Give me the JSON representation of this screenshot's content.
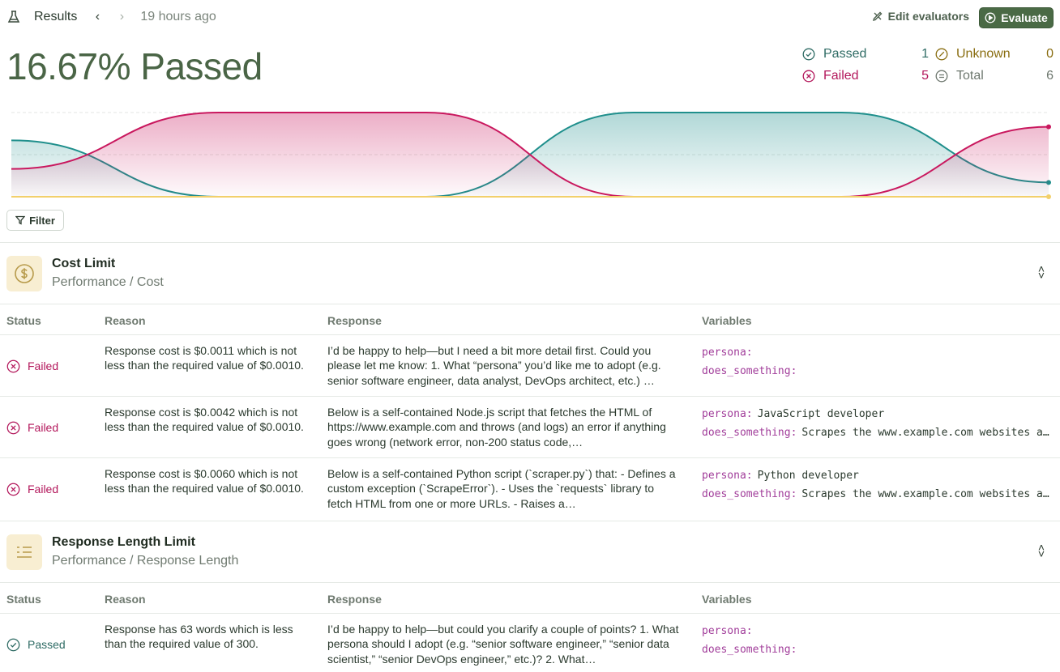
{
  "header": {
    "title": "Results",
    "time": "19 hours ago",
    "edit_evaluators": "Edit evaluators",
    "evaluate": "Evaluate"
  },
  "summary": {
    "headline": "16.67% Passed",
    "passed_label": "Passed",
    "passed_count": "1",
    "unknown_label": "Unknown",
    "unknown_count": "0",
    "failed_label": "Failed",
    "failed_count": "5",
    "total_label": "Total",
    "total_count": "6"
  },
  "chart_data": {
    "type": "area",
    "x": [
      0,
      1,
      2,
      3,
      4,
      5
    ],
    "series": [
      {
        "color": "#c9185e",
        "values": [
          0.33,
          1,
          1,
          0,
          0,
          0.83
        ]
      },
      {
        "color": "#1f8f8c",
        "values": [
          0.67,
          0,
          0,
          1,
          1,
          0.17
        ]
      },
      {
        "color": "#f2d06b",
        "values": [
          0,
          0,
          0,
          0,
          0,
          0
        ]
      }
    ],
    "ylim": [
      0,
      1
    ]
  },
  "filter": {
    "label": "Filter"
  },
  "columns": {
    "status": "Status",
    "reason": "Reason",
    "response": "Response",
    "variables": "Variables"
  },
  "sections": [
    {
      "title": "Cost Limit",
      "subtitle": "Performance / Cost",
      "rows": [
        {
          "status": "Failed",
          "reason": "Response cost is $0.0011 which is not less than the required value of $0.0010.",
          "response": "I’d be happy to help—but I need a bit more detail first. Could you please let me know: 1. What “persona” you’d like me to adopt (e.g. senior software engineer, data analyst, DevOps architect, etc.) …",
          "persona": "",
          "does_something": ""
        },
        {
          "status": "Failed",
          "reason": "Response cost is $0.0042 which is not less than the required value of $0.0010.",
          "response": "Below is a self-contained Node.js script that fetches the HTML of https://www.example.com and throws (and logs) an error if anything goes wrong (network error, non-200 status code,…",
          "persona": "JavaScript developer",
          "does_something": "Scrapes the www.example.com websites and throws an error"
        },
        {
          "status": "Failed",
          "reason": "Response cost is $0.0060 which is not less than the required value of $0.0010.",
          "response": "Below is a self-contained Python script (`scraper.py`) that: - Defines a custom exception (`ScrapeError`). - Uses the `requests` library to fetch HTML from one or more URLs. - Raises a…",
          "persona": "Python developer",
          "does_something": "Scrapes the www.example.com websites and throws an error"
        }
      ]
    },
    {
      "title": "Response Length Limit",
      "subtitle": "Performance / Response Length",
      "rows": [
        {
          "status": "Passed",
          "reason": "Response has 63 words which is less than the required value of 300.",
          "response": "I’d be happy to help—but could you clarify a couple of points? 1. What persona should I adopt (e.g. “senior software engineer,” “senior data scientist,” “senior DevOps engineer,” etc.)? 2. What…",
          "persona": "",
          "does_something": ""
        }
      ]
    }
  ],
  "variables": {
    "persona_key": "persona:",
    "does_key": "does_something:"
  }
}
